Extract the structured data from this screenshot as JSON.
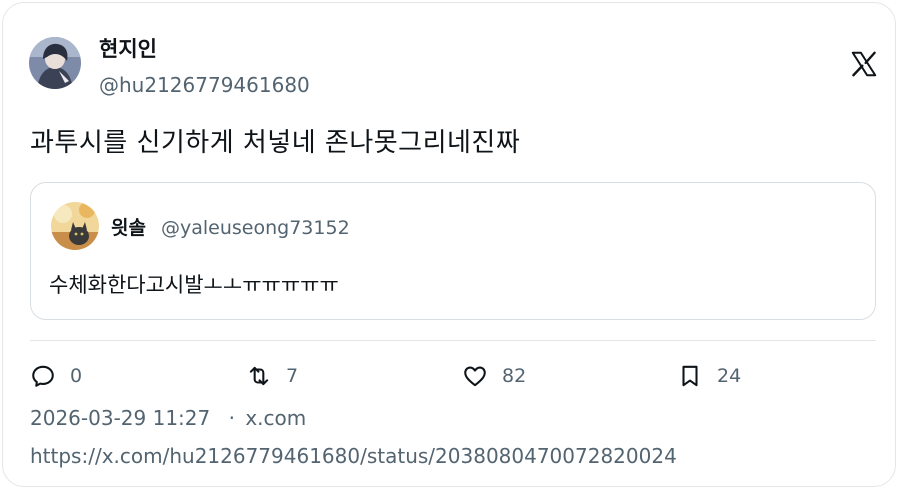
{
  "author": {
    "display_name": "현지인",
    "handle": "@hu2126779461680"
  },
  "brand_icon": "x-logo-icon",
  "tweet": {
    "text": "과투시를 신기하게 처넣네 존나못그리네진짜"
  },
  "quoted": {
    "display_name": "읫솔",
    "handle": "@yaleuseong73152",
    "text": "수체화한다고시발ㅗㅗㅠㅠㅠㅠㅠ"
  },
  "actions": {
    "reply": {
      "icon": "reply-icon",
      "count": "0"
    },
    "retweet": {
      "icon": "retweet-icon",
      "count": "7"
    },
    "like": {
      "icon": "heart-icon",
      "count": "82"
    },
    "bookmark": {
      "icon": "bookmark-icon",
      "count": "24"
    }
  },
  "meta": {
    "timestamp": "2026-03-29 11:27",
    "separator": "·",
    "source": "x.com",
    "url": "https://x.com/hu2126779461680/status/2038080470072820024"
  },
  "colors": {
    "text_primary": "#0f1419",
    "text_secondary": "#536471",
    "border": "#e3e7ea"
  }
}
